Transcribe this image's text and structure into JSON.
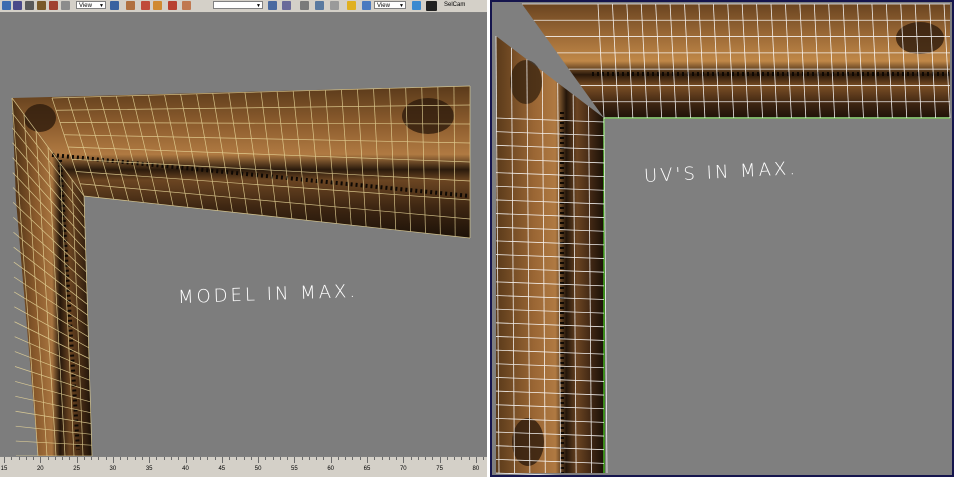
{
  "toolbar": {
    "view_dropdown_1": "View",
    "view_dropdown_2": "View",
    "camera_label": "SelCam",
    "select_dropdown": ""
  },
  "viewport_left": {
    "annotation": "MODEL IN MAX."
  },
  "viewport_right": {
    "annotation": "UV'S IN MAX."
  },
  "timeline": {
    "ticks": [
      "15",
      "20",
      "25",
      "30",
      "35",
      "40",
      "45",
      "50",
      "55",
      "60",
      "65",
      "70",
      "75",
      "80"
    ]
  },
  "colors": {
    "wood_dark": "#3b2410",
    "wood_light": "#9a6a38",
    "wireframe": "#e8d79a",
    "uv_lines": "#ffffff",
    "viewport_bg": "#7d7d7d",
    "active_border": "#15154d"
  }
}
